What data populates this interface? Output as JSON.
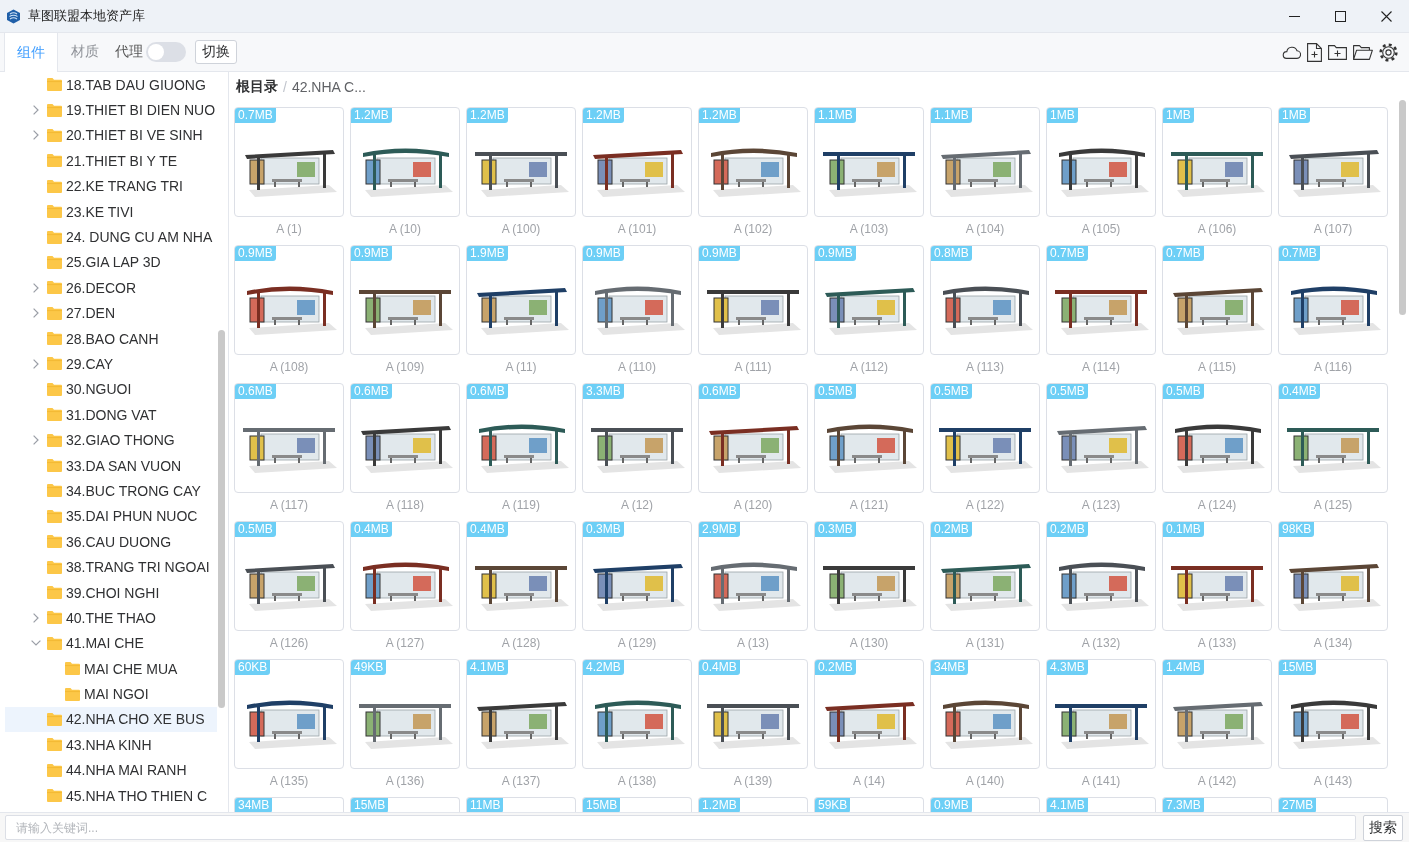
{
  "window": {
    "title": "草图联盟本地资产库"
  },
  "tabs": [
    {
      "label": "组件",
      "selected": true
    },
    {
      "label": "材质",
      "selected": false
    }
  ],
  "proxy": {
    "label": "代理",
    "on": false
  },
  "switch_button": {
    "label": "切换"
  },
  "sidebar": {
    "items": [
      {
        "label": "18.TAB DAU GIUONG",
        "kind": "leaf",
        "selected": false
      },
      {
        "label": "19.THIET BI DIEN NUO",
        "kind": "branch",
        "expanded": false,
        "selected": false
      },
      {
        "label": "20.THIET BI VE SINH",
        "kind": "branch",
        "expanded": false,
        "selected": false
      },
      {
        "label": "21.THIET BI Y TE",
        "kind": "leaf",
        "selected": false
      },
      {
        "label": "22.KE TRANG TRI",
        "kind": "leaf",
        "selected": false
      },
      {
        "label": "23.KE TIVI",
        "kind": "leaf",
        "selected": false
      },
      {
        "label": "24. DUNG CU AM NHA",
        "kind": "leaf",
        "selected": false
      },
      {
        "label": "25.GIA LAP 3D",
        "kind": "leaf",
        "selected": false
      },
      {
        "label": "26.DECOR",
        "kind": "branch",
        "expanded": false,
        "selected": false
      },
      {
        "label": "27.DEN",
        "kind": "branch",
        "expanded": false,
        "selected": false
      },
      {
        "label": "28.BAO CANH",
        "kind": "leaf",
        "selected": false
      },
      {
        "label": "29.CAY",
        "kind": "branch",
        "expanded": false,
        "selected": false
      },
      {
        "label": "30.NGUOI",
        "kind": "leaf",
        "selected": false
      },
      {
        "label": "31.DONG VAT",
        "kind": "leaf",
        "selected": false
      },
      {
        "label": "32.GIAO THONG",
        "kind": "branch",
        "expanded": false,
        "selected": false
      },
      {
        "label": "33.DA SAN VUON",
        "kind": "leaf",
        "selected": false
      },
      {
        "label": "34.BUC TRONG CAY",
        "kind": "leaf",
        "selected": false
      },
      {
        "label": "35.DAI PHUN NUOC",
        "kind": "leaf",
        "selected": false
      },
      {
        "label": "36.CAU DUONG",
        "kind": "leaf",
        "selected": false
      },
      {
        "label": "38.TRANG TRI NGOAI",
        "kind": "leaf",
        "selected": false
      },
      {
        "label": "39.CHOI NGHI",
        "kind": "leaf",
        "selected": false
      },
      {
        "label": "40.THE THAO",
        "kind": "branch",
        "expanded": false,
        "selected": false
      },
      {
        "label": "41.MAI CHE",
        "kind": "branch",
        "expanded": true,
        "selected": false,
        "children": [
          {
            "label": "MAI CHE MUA",
            "kind": "leaf",
            "selected": false
          },
          {
            "label": "MAI NGOI",
            "kind": "leaf",
            "selected": false
          }
        ]
      },
      {
        "label": "42.NHA CHO XE BUS",
        "kind": "leaf",
        "selected": true
      },
      {
        "label": "43.NHA KINH",
        "kind": "leaf",
        "selected": false
      },
      {
        "label": "44.NHA MAI RANH",
        "kind": "leaf",
        "selected": false
      },
      {
        "label": "45.NHA THO THIEN C",
        "kind": "leaf",
        "selected": false
      }
    ]
  },
  "breadcrumb": {
    "separator": "/",
    "items": [
      {
        "label": "根目录",
        "current": false
      },
      {
        "label": "42.NHA C...",
        "current": true
      }
    ]
  },
  "assets": [
    {
      "size": "0.7MB",
      "name": "A (1)"
    },
    {
      "size": "1.2MB",
      "name": "A (10)"
    },
    {
      "size": "1.2MB",
      "name": "A (100)"
    },
    {
      "size": "1.2MB",
      "name": "A (101)"
    },
    {
      "size": "1.2MB",
      "name": "A (102)"
    },
    {
      "size": "1.1MB",
      "name": "A (103)"
    },
    {
      "size": "1.1MB",
      "name": "A (104)"
    },
    {
      "size": "1MB",
      "name": "A (105)"
    },
    {
      "size": "1MB",
      "name": "A (106)"
    },
    {
      "size": "1MB",
      "name": "A (107)"
    },
    {
      "size": "0.9MB",
      "name": "A (108)"
    },
    {
      "size": "0.9MB",
      "name": "A (109)"
    },
    {
      "size": "1.9MB",
      "name": "A (11)"
    },
    {
      "size": "0.9MB",
      "name": "A (110)"
    },
    {
      "size": "0.9MB",
      "name": "A (111)"
    },
    {
      "size": "0.9MB",
      "name": "A (112)"
    },
    {
      "size": "0.8MB",
      "name": "A (113)"
    },
    {
      "size": "0.7MB",
      "name": "A (114)"
    },
    {
      "size": "0.7MB",
      "name": "A (115)"
    },
    {
      "size": "0.7MB",
      "name": "A (116)"
    },
    {
      "size": "0.6MB",
      "name": "A (117)"
    },
    {
      "size": "0.6MB",
      "name": "A (118)"
    },
    {
      "size": "0.6MB",
      "name": "A (119)"
    },
    {
      "size": "3.3MB",
      "name": "A (12)"
    },
    {
      "size": "0.6MB",
      "name": "A (120)"
    },
    {
      "size": "0.5MB",
      "name": "A (121)"
    },
    {
      "size": "0.5MB",
      "name": "A (122)"
    },
    {
      "size": "0.5MB",
      "name": "A (123)"
    },
    {
      "size": "0.5MB",
      "name": "A (124)"
    },
    {
      "size": "0.4MB",
      "name": "A (125)"
    },
    {
      "size": "0.5MB",
      "name": "A (126)"
    },
    {
      "size": "0.4MB",
      "name": "A (127)"
    },
    {
      "size": "0.4MB",
      "name": "A (128)"
    },
    {
      "size": "0.3MB",
      "name": "A (129)"
    },
    {
      "size": "2.9MB",
      "name": "A (13)"
    },
    {
      "size": "0.3MB",
      "name": "A (130)"
    },
    {
      "size": "0.2MB",
      "name": "A (131)"
    },
    {
      "size": "0.2MB",
      "name": "A (132)"
    },
    {
      "size": "0.1MB",
      "name": "A (133)"
    },
    {
      "size": "98KB",
      "name": "A (134)"
    },
    {
      "size": "60KB",
      "name": "A (135)"
    },
    {
      "size": "49KB",
      "name": "A (136)"
    },
    {
      "size": "4.1MB",
      "name": "A (137)"
    },
    {
      "size": "4.2MB",
      "name": "A (138)"
    },
    {
      "size": "0.4MB",
      "name": "A (139)"
    },
    {
      "size": "0.2MB",
      "name": "A (14)"
    },
    {
      "size": "34MB",
      "name": "A (140)"
    },
    {
      "size": "4.3MB",
      "name": "A (141)"
    },
    {
      "size": "1.4MB",
      "name": "A (142)"
    },
    {
      "size": "15MB",
      "name": "A (143)"
    },
    {
      "size": "34MB"
    },
    {
      "size": "15MB"
    },
    {
      "size": "11MB"
    },
    {
      "size": "15MB"
    },
    {
      "size": "1.2MB"
    },
    {
      "size": "59KB"
    },
    {
      "size": "0.9MB"
    },
    {
      "size": "4.1MB"
    },
    {
      "size": "7.3MB"
    },
    {
      "size": "27MB"
    }
  ],
  "search": {
    "placeholder": "请输入关键词...",
    "button": "搜索"
  }
}
